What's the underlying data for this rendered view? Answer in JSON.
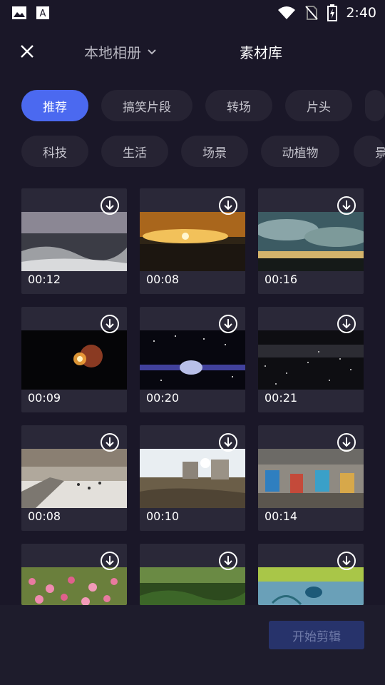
{
  "status_bar": {
    "icons_left": [
      "gallery-icon",
      "text-a-icon"
    ],
    "icons_right": [
      "wifi-icon",
      "no-sim-icon",
      "battery-charging-icon"
    ],
    "time": "2:40"
  },
  "header": {
    "close_icon": "close-icon",
    "album_switch_label": "本地相册",
    "album_switch_icon": "chevron-down-icon",
    "library_title": "素材库"
  },
  "categories_row1": [
    {
      "label": "推荐",
      "active": true
    },
    {
      "label": "搞笑片段",
      "active": false
    },
    {
      "label": "转场",
      "active": false
    },
    {
      "label": "片头",
      "active": false
    },
    {
      "label": "",
      "active": false
    }
  ],
  "categories_row2": [
    {
      "label": "科技"
    },
    {
      "label": "生活"
    },
    {
      "label": "场景"
    },
    {
      "label": "动植物"
    },
    {
      "label": "景"
    }
  ],
  "grid": [
    {
      "duration": "00:12",
      "scene": "snowy aerial"
    },
    {
      "duration": "00:08",
      "scene": "sunset"
    },
    {
      "duration": "00:16",
      "scene": "clouds"
    },
    {
      "duration": "00:09",
      "scene": "planet"
    },
    {
      "duration": "00:20",
      "scene": "brain"
    },
    {
      "duration": "00:21",
      "scene": "stars"
    },
    {
      "duration": "00:08",
      "scene": "mall"
    },
    {
      "duration": "00:10",
      "scene": "ruins"
    },
    {
      "duration": "00:14",
      "scene": "carousel"
    },
    {
      "duration": "",
      "scene": "flowers"
    },
    {
      "duration": "",
      "scene": "grass"
    },
    {
      "duration": "",
      "scene": "bird"
    }
  ],
  "bottom": {
    "start_label": "开始剪辑"
  },
  "colors": {
    "background": "#1a1728",
    "accent": "#4b69f0",
    "chip": "#262333",
    "card": "#2a2838"
  }
}
